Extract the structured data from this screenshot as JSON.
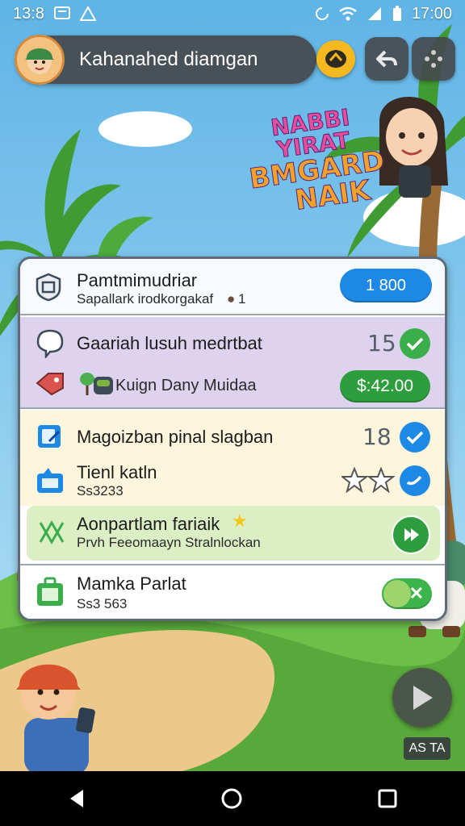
{
  "status_bar": {
    "time_left": "13:8",
    "time_right": "17:00"
  },
  "header": {
    "title": "Kahanahed diamgan",
    "icons": [
      "avatar",
      "coin-icon",
      "back-arrow-icon",
      "dpad-icon"
    ]
  },
  "banner": {
    "line1": "NABBI YIRAT",
    "line2": "BMGARD",
    "line3": "NAIK"
  },
  "list": {
    "header": {
      "title": "Pamtmimudriar",
      "subtitle": "Sapallark irodkorgakaf",
      "subtitle_count": "1",
      "price": "1 800"
    },
    "item1": {
      "title": "Gaariah lusuh medrtbat",
      "count": "15"
    },
    "item2": {
      "title": "Kuign Dany Muidaa",
      "price": "$:42.00"
    },
    "item3": {
      "title": "Magoizban pinal slagban",
      "count": "18"
    },
    "item4": {
      "title": "Tienl katln",
      "subtitle": "Ss3233",
      "rating_stars": 2
    },
    "item5": {
      "title": "Aonpartlam fariaik",
      "subtitle": "Prvh Feeomaayn Stralnlockan"
    },
    "item6": {
      "title": "Mamka Parlat",
      "subtitle": "Ss3 563",
      "toggle_on": true
    }
  },
  "ads_label": "AS TA",
  "colors": {
    "blue_pill": "#1e88e5",
    "green_pill": "#2e9d3e",
    "panel_border": "#5f6b78"
  }
}
